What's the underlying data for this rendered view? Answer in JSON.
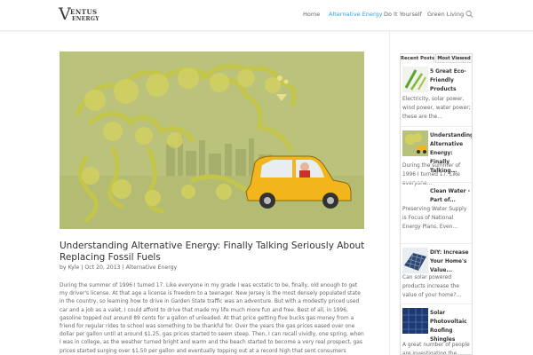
{
  "brand": {
    "logo_v": "V",
    "logo_top": "ENTUS",
    "logo_bottom": "ENERGY"
  },
  "nav": {
    "items": [
      "Home",
      "Alternative Energy",
      "Do It Yourself",
      "Green Living"
    ],
    "active_index": 1,
    "search_icon": "search-icon"
  },
  "post": {
    "title": "Understanding Alternative Energy: Finally Talking Seriously About Replacing Fossil Fuels",
    "author": "Kyle",
    "date": "Oct 20, 2013",
    "category": "Alternative Energy",
    "meta_by": "by",
    "meta_sep": "|",
    "body": "During the summer of 1996 I turned 17. Like everyone in my grade I was ecstatic to be, finally, old enough to get my driver's license. At that age a license is freedom to a teenager. New Jersey is the most densely populated state in the country, so learning how to drive in Garden State traffic was an adventure. But with a modestly priced used car and a job as a valet, I could afford to drive that made my life much more fun and free. Best of all, in 1996, gasoline topped out around 89 cents for a gallon of unleaded. At that price getting five bucks gas money from a friend for regular rides to school was something to be thankful for. Over the years the gas prices eased over one dollar per gallon until at around $1.25, gas prices started to seem steep. Then, I can recall vividly, one spring, when I was in college, as the weather turned bright and warm and the beach started to become a very real prospect, gas prices started surging over $1.50 per gallon and eventually topping out at a record high that sent consumers reeling."
  },
  "sidebar": {
    "tabs": [
      "Recent Posts",
      "Most Viewed"
    ],
    "active_tab": 0,
    "items": [
      {
        "title": "5 Great Eco-Friendly Products",
        "excerpt": "Electricity, solar power, wind power, water power; these are the..."
      },
      {
        "title": "Understanding Alternative Energy: Finally Talking...",
        "excerpt": "During the summer of 1996 I turned 17. Like everyone..."
      },
      {
        "title": "Clean Water - Part of...",
        "excerpt": "Preserving Water Supply is Focus of National Energy Plans, Even..."
      },
      {
        "title": "DIY: Increase Your Home's Value...",
        "excerpt": "Can solar powered products increase the value of your home?..."
      },
      {
        "title": "Solar Photovoltaic Roofing Shingles",
        "excerpt": "A great number of people are investigating the..."
      }
    ]
  },
  "colors": {
    "accent": "#2ea3f2",
    "hero_bg": "#b9c27a",
    "smoke": "#c9cc52",
    "car": "#f3b51c"
  }
}
